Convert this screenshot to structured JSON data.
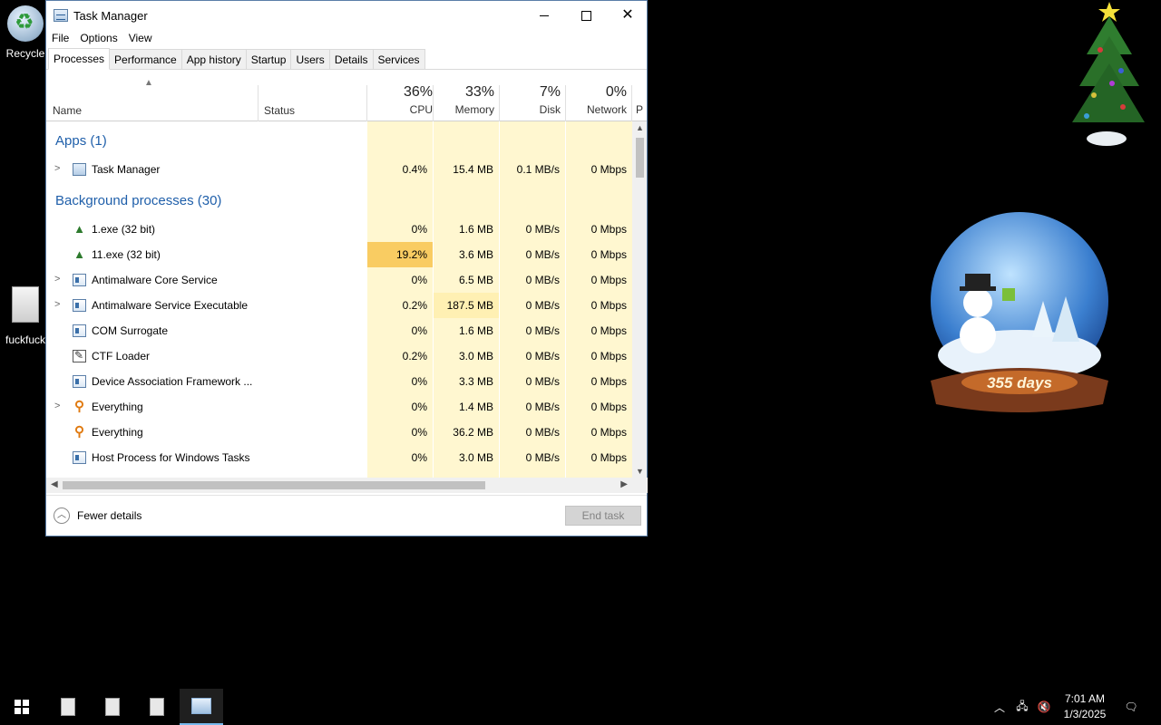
{
  "desktop": {
    "recycle_label": "Recycle",
    "file_label": "fuckfuck"
  },
  "window": {
    "title": "Task Manager",
    "menu": [
      "File",
      "Options",
      "View"
    ],
    "tabs": [
      "Processes",
      "Performance",
      "App history",
      "Startup",
      "Users",
      "Details",
      "Services"
    ],
    "active_tab": "Processes"
  },
  "columns": {
    "name": "Name",
    "status": "Status",
    "cpu": {
      "pct": "36%",
      "label": "CPU"
    },
    "memory": {
      "pct": "33%",
      "label": "Memory"
    },
    "disk": {
      "pct": "7%",
      "label": "Disk"
    },
    "network": {
      "pct": "0%",
      "label": "Network"
    },
    "power_partial": "P"
  },
  "groups": {
    "apps": "Apps (1)",
    "background": "Background processes (30)"
  },
  "apps": [
    {
      "name": "Task Manager",
      "icon": "task-manager-icon",
      "expandable": true,
      "cpu": "0.4%",
      "memory": "15.4 MB",
      "disk": "0.1 MB/s",
      "network": "0 Mbps"
    }
  ],
  "processes": [
    {
      "name": "1.exe (32 bit)",
      "icon": "tree-icon",
      "expandable": false,
      "cpu": "0%",
      "memory": "1.6 MB",
      "disk": "0 MB/s",
      "network": "0 Mbps"
    },
    {
      "name": "11.exe (32 bit)",
      "icon": "tree-icon",
      "expandable": false,
      "cpu": "19.2%",
      "memory": "3.6 MB",
      "disk": "0 MB/s",
      "network": "0 Mbps"
    },
    {
      "name": "Antimalware Core Service",
      "icon": "service-icon",
      "expandable": true,
      "cpu": "0%",
      "memory": "6.5 MB",
      "disk": "0 MB/s",
      "network": "0 Mbps"
    },
    {
      "name": "Antimalware Service Executable",
      "icon": "service-icon",
      "expandable": true,
      "cpu": "0.2%",
      "memory": "187.5 MB",
      "disk": "0 MB/s",
      "network": "0 Mbps"
    },
    {
      "name": "COM Surrogate",
      "icon": "service-icon",
      "expandable": false,
      "cpu": "0%",
      "memory": "1.6 MB",
      "disk": "0 MB/s",
      "network": "0 Mbps"
    },
    {
      "name": "CTF Loader",
      "icon": "pen-icon",
      "expandable": false,
      "cpu": "0.2%",
      "memory": "3.0 MB",
      "disk": "0 MB/s",
      "network": "0 Mbps"
    },
    {
      "name": "Device Association Framework ...",
      "icon": "service-icon",
      "expandable": false,
      "cpu": "0%",
      "memory": "3.3 MB",
      "disk": "0 MB/s",
      "network": "0 Mbps"
    },
    {
      "name": "Everything",
      "icon": "search-icon",
      "expandable": true,
      "cpu": "0%",
      "memory": "1.4 MB",
      "disk": "0 MB/s",
      "network": "0 Mbps"
    },
    {
      "name": "Everything",
      "icon": "search-icon",
      "expandable": false,
      "cpu": "0%",
      "memory": "36.2 MB",
      "disk": "0 MB/s",
      "network": "0 Mbps"
    },
    {
      "name": "Host Process for Windows Tasks",
      "icon": "service-icon",
      "expandable": false,
      "cpu": "0%",
      "memory": "3.0 MB",
      "disk": "0 MB/s",
      "network": "0 Mbps"
    }
  ],
  "footer": {
    "fewer_details": "Fewer details",
    "end_task": "End task"
  },
  "snowglobe_text": "355 days",
  "taskbar": {
    "time": "7:01 AM",
    "date": "1/3/2025"
  },
  "colors": {
    "group_blue": "#1f5faa",
    "cpu_high": "#f9cc62",
    "cell_bg": "#fff7d0",
    "cell_bg_mid": "#fff0b3"
  }
}
